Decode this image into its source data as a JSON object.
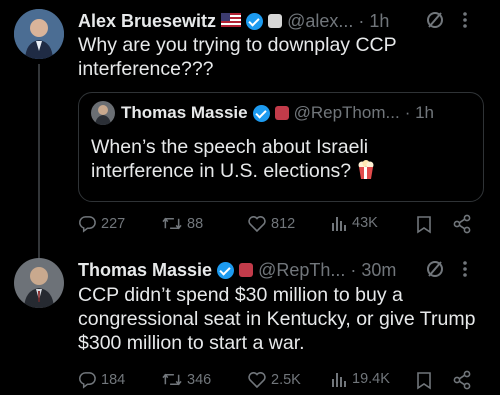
{
  "tweet1": {
    "name": "Alex Bruesewitz",
    "handle": "@alex...",
    "time": "· 1h",
    "text_lines": [
      "Why are you trying to downplay CCP",
      "interference???"
    ],
    "flag_icon": "us-flag-icon",
    "affiliate_icon": "affiliate-badge-icon"
  },
  "quote": {
    "name": "Thomas Massie",
    "handle": "@RepThom...",
    "time": "· 1h",
    "text_lines": [
      "When’s the speech about Israeli",
      "interference in U.S. elections?"
    ],
    "emoji_icon": "popcorn-icon"
  },
  "actions1": {
    "replies": "227",
    "reposts": "88",
    "likes": "812",
    "views": "43K"
  },
  "tweet2": {
    "name": "Thomas Massie",
    "handle": "@RepTh...",
    "time": "· 30m",
    "text_lines": [
      "CCP didn’t spend $30 million to buy a",
      "congressional seat in Kentucky, or give Trump",
      "$300 million to start a war."
    ]
  },
  "actions2": {
    "replies": "184",
    "reposts": "346",
    "likes": "2.5K",
    "views": "19.4K"
  },
  "colors": {
    "background": "#000000",
    "text": "#e7e9ea",
    "muted": "#71767b",
    "verified": "#1d9bf0",
    "border": "#2f3336"
  }
}
